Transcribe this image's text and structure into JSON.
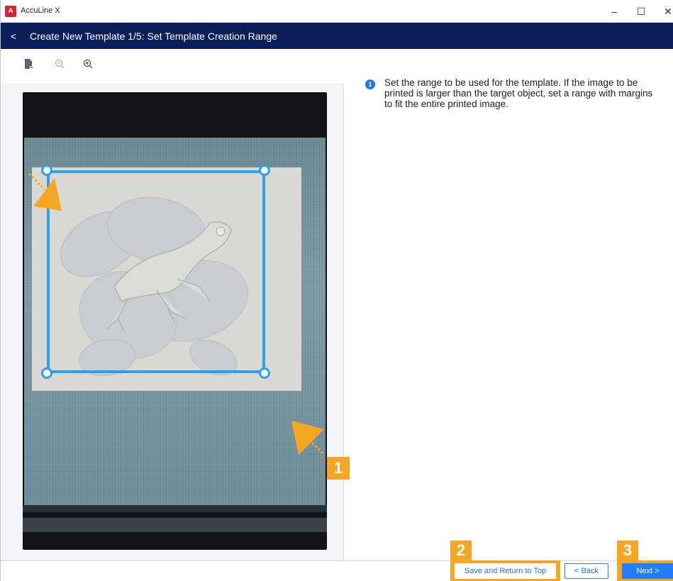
{
  "window": {
    "app_title": "AccuLine X",
    "logo_text": "A",
    "controls": {
      "minimize": "–",
      "maximize": "☐",
      "close": "✕"
    }
  },
  "header": {
    "back_icon": "chevron-left-icon",
    "back_glyph": "<",
    "title": "Create New Template 1/5: Set Template Creation Range"
  },
  "toolbar": {
    "tools": [
      {
        "name": "file-image-icon"
      },
      {
        "name": "zoom-out-icon"
      },
      {
        "name": "zoom-in-icon"
      }
    ]
  },
  "instructions": {
    "step_badge": "1",
    "text": "Set the range to be used for the template. If the image to be printed is larger than the target object, set a range with margins to fit the entire printed image."
  },
  "callouts": {
    "one": "1",
    "two": "2",
    "three": "3"
  },
  "footer": {
    "save_label": "Save and Return to Top",
    "back_label": "< Back",
    "next_label": "Next >"
  },
  "colors": {
    "header_bg": "#0b1f5c",
    "selection": "#2aa1f0",
    "callout": "#f5a623",
    "primary_button": "#1f7fff"
  }
}
